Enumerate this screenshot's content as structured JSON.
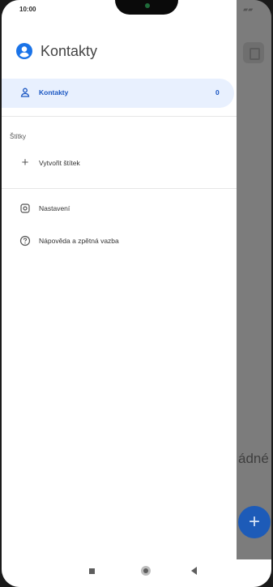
{
  "status_bar": {
    "time": "10:00"
  },
  "drawer": {
    "app_title": "Kontakty",
    "active_item": {
      "label": "Kontakty",
      "count": "0"
    },
    "labels_header": "Štítky",
    "create_label": "Vytvořit štítek",
    "settings": "Nastavení",
    "help": "Nápověda a zpětná vazba"
  },
  "background": {
    "empty_text": "ádné"
  },
  "colors": {
    "accent": "#1a56c2",
    "active_bg": "#e8f0fe",
    "fab": "#1d5bb8"
  },
  "icons": {
    "account": "account-circle-icon",
    "contacts": "person-outline-icon",
    "create": "plus-icon",
    "settings": "gear-icon",
    "help": "help-circle-icon",
    "fab": "plus-icon"
  }
}
